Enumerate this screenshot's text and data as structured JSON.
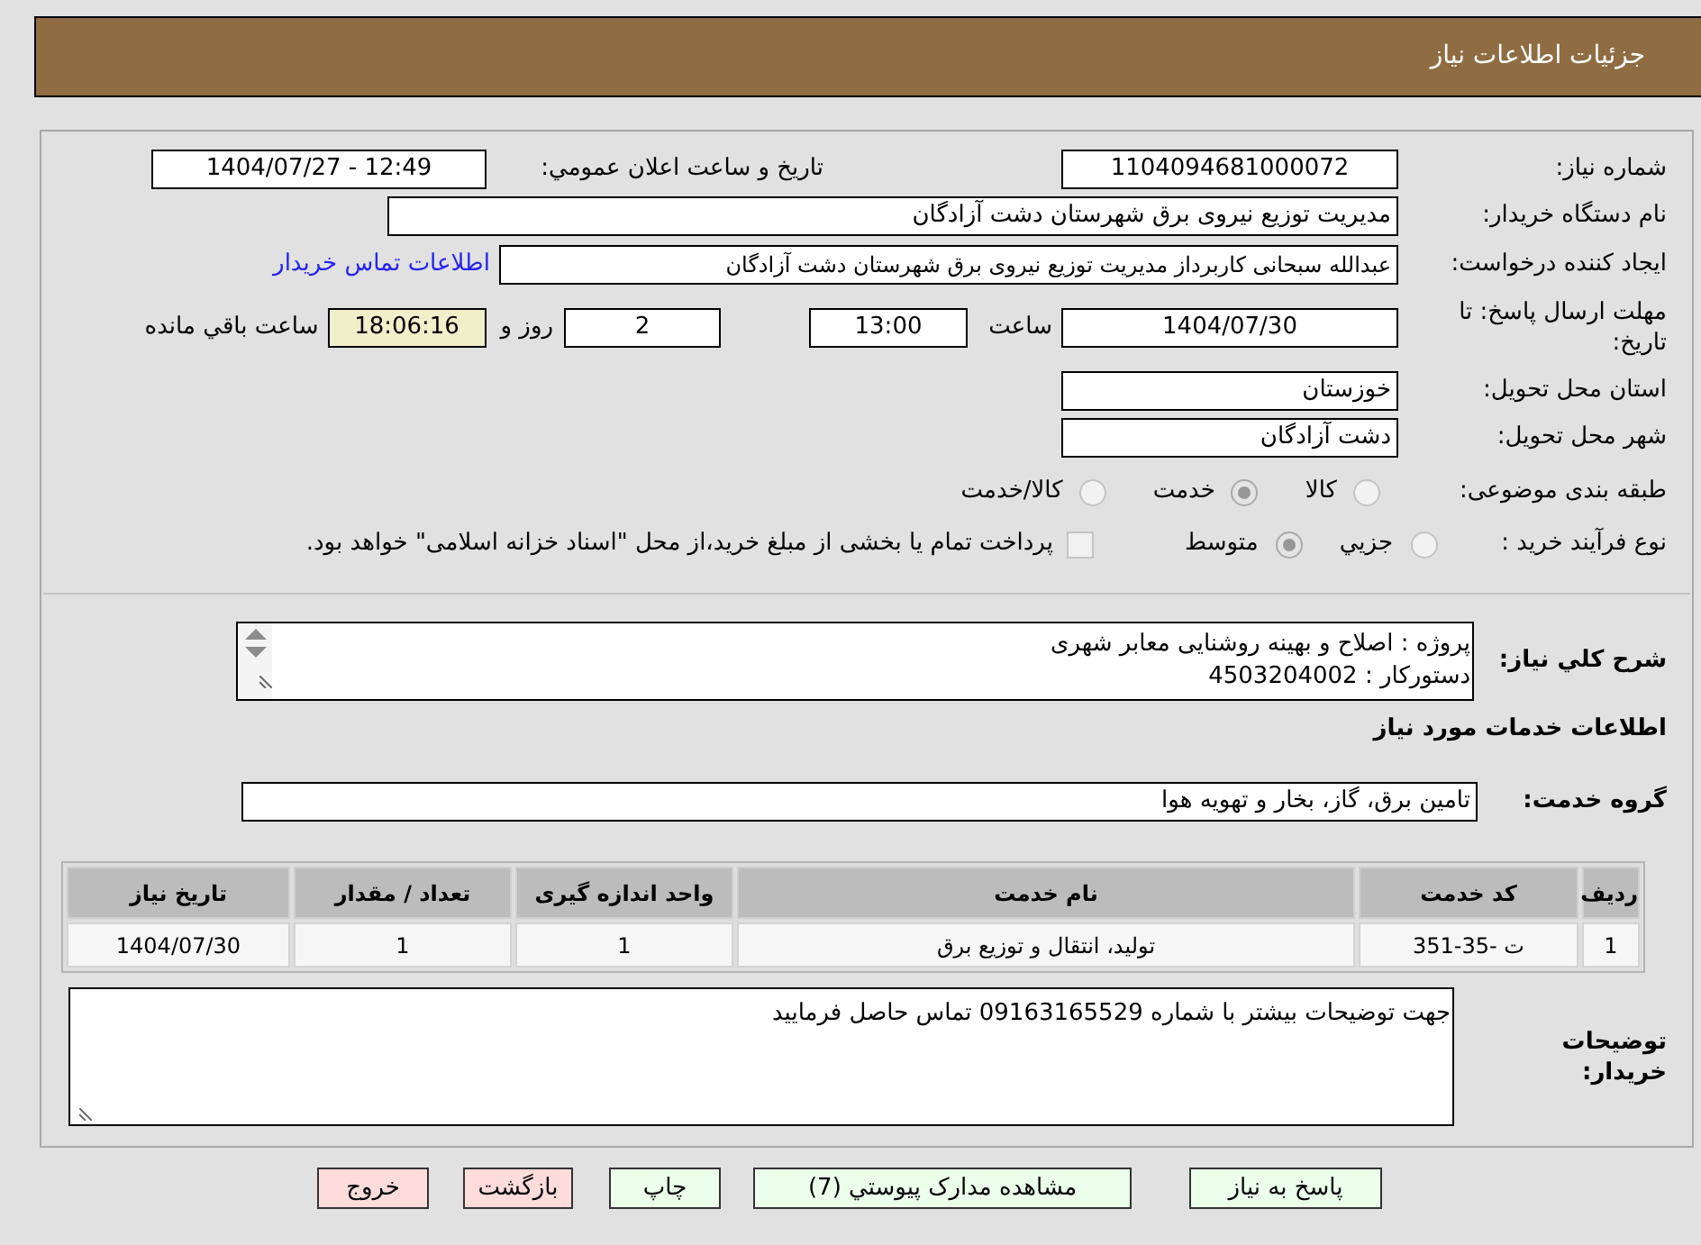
{
  "header": {
    "title": "جزئیات اطلاعات نیاز"
  },
  "form": {
    "need_number": {
      "label": "شماره نیاز:",
      "value": "1104094681000072"
    },
    "announce": {
      "label": "تاريخ و ساعت اعلان عمومي:",
      "value": "1404/07/27 - 12:49"
    },
    "buyer_org": {
      "label": "نام دستگاه خريدار:",
      "value": "مدیریت توزیع نیروی برق شهرستان دشت آزادگان"
    },
    "requester": {
      "label": "ایجاد کننده درخواست:",
      "value": "عبدالله سبحانی کاربرداز مدیریت توزیع نیروی برق شهرستان دشت آزادگان",
      "link": "اطلاعات تماس خريدار"
    },
    "deadline": {
      "label": "مهلت ارسال پاسخ: تا تاریخ:",
      "date": "1404/07/30",
      "time_label": "ساعت",
      "time": "13:00",
      "days": "2",
      "days_label": "روز و",
      "remaining": "18:06:16",
      "remaining_label": "ساعت باقي مانده"
    },
    "province": {
      "label": "استان محل تحویل:",
      "value": "خوزستان"
    },
    "city": {
      "label": "شهر محل تحویل:",
      "value": "دشت آزادگان"
    },
    "category": {
      "label": "طبقه بندی موضوعی:",
      "options": [
        {
          "label": "کالا",
          "selected": false
        },
        {
          "label": "خدمت",
          "selected": true
        },
        {
          "label": "کالا/خدمت",
          "selected": false
        }
      ]
    },
    "purchase_type": {
      "label": "نوع فرآیند خرید :",
      "options": [
        {
          "label": "جزيي",
          "selected": false
        },
        {
          "label": "متوسط",
          "selected": true
        }
      ],
      "treasury_payment": {
        "label": "پرداخت تمام يا بخشی از مبلغ خرید،از محل \"اسناد خزانه اسلامی\" خواهد بود.",
        "checked": false
      }
    }
  },
  "description": {
    "label": "شرح كلي نياز:",
    "lines": [
      "پروژه : اصلاح و بهینه روشنایی معابر شهری",
      "دستورکار : 4503204002"
    ]
  },
  "services": {
    "title": "اطلاعات خدمات مورد نیاز",
    "group_label": "گروه خدمت:",
    "group": "تامین برق، گاز، بخار و تهویه هوا"
  },
  "table": {
    "columns": [
      "ردیف",
      "کد خدمت",
      "نام خدمت",
      "واحد اندازه گیری",
      "تعداد / مقدار",
      "تاریخ نیاز"
    ],
    "rows": [
      [
        "1",
        "ت -35-351",
        "تولید، انتقال و توزیع برق",
        "1",
        "1",
        "1404/07/30"
      ]
    ]
  },
  "buyer_notes": {
    "label": "توضیحات خریدار:",
    "value": "جهت توضیحات بیشتر با شماره 09163165529 تماس حاصل فرمایید"
  },
  "buttons": [
    {
      "label": "پاسخ به نیاز",
      "kind": "proceed"
    },
    {
      "label": "مشاهده مدارک پیوستي (7)",
      "kind": "proceed"
    },
    {
      "label": "چاپ",
      "kind": "proceed"
    },
    {
      "label": "بازگشت",
      "kind": "cancel"
    },
    {
      "label": "خروج",
      "kind": "cancel"
    }
  ]
}
